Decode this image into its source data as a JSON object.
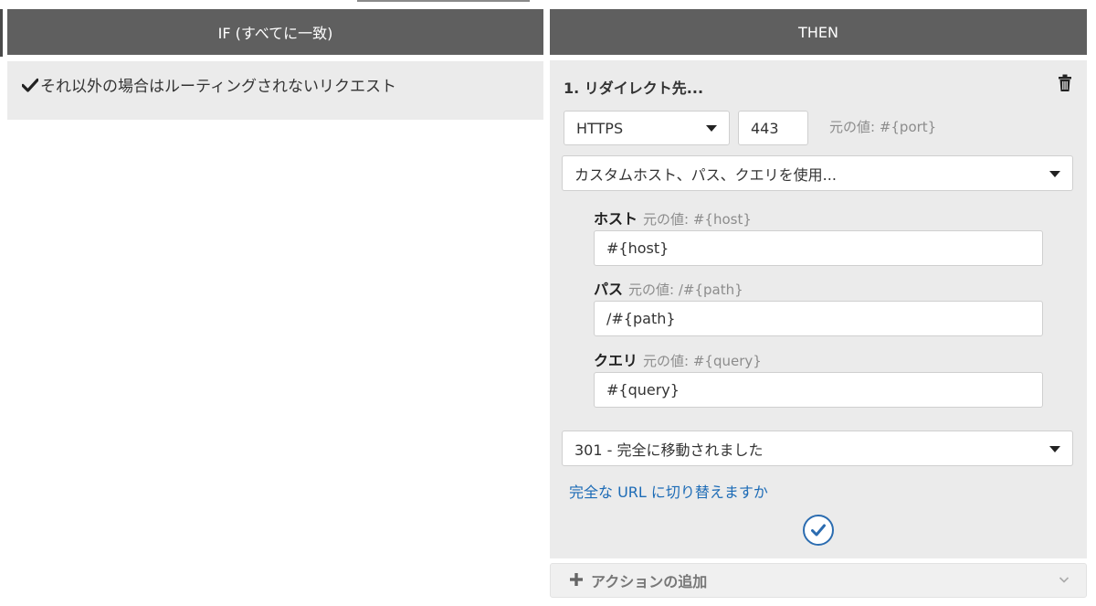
{
  "if_header": "IF (すべてに一致)",
  "then_header": "THEN",
  "if_condition": "それ以外の場合はルーティングされないリクエスト",
  "action": {
    "title": "1. リダイレクト先...",
    "protocol": "HTTPS",
    "port": "443",
    "port_hint": "元の値: #{port}",
    "mode": "カスタムホスト、パス、クエリを使用...",
    "host_label": "ホスト",
    "host_hint": "元の値: #{host}",
    "host_value": "#{host}",
    "path_label": "パス",
    "path_hint": "元の値: /#{path}",
    "path_value": "/#{path}",
    "query_label": "クエリ",
    "query_hint": "元の値: #{query}",
    "query_value": "#{query}",
    "status": "301 - 完全に移動されました",
    "switch_link": "完全な URL に切り替えますか"
  },
  "add_action": "アクションの追加",
  "icons": {
    "check": "check-icon",
    "trash": "trash-icon",
    "confirm": "check-circle-icon",
    "plus": "plus-icon",
    "chevron": "chevron-down-icon"
  },
  "colors": {
    "header_bg": "#5f5f5f",
    "panel_bg": "#ebebeb",
    "link": "#1c6bb6"
  }
}
